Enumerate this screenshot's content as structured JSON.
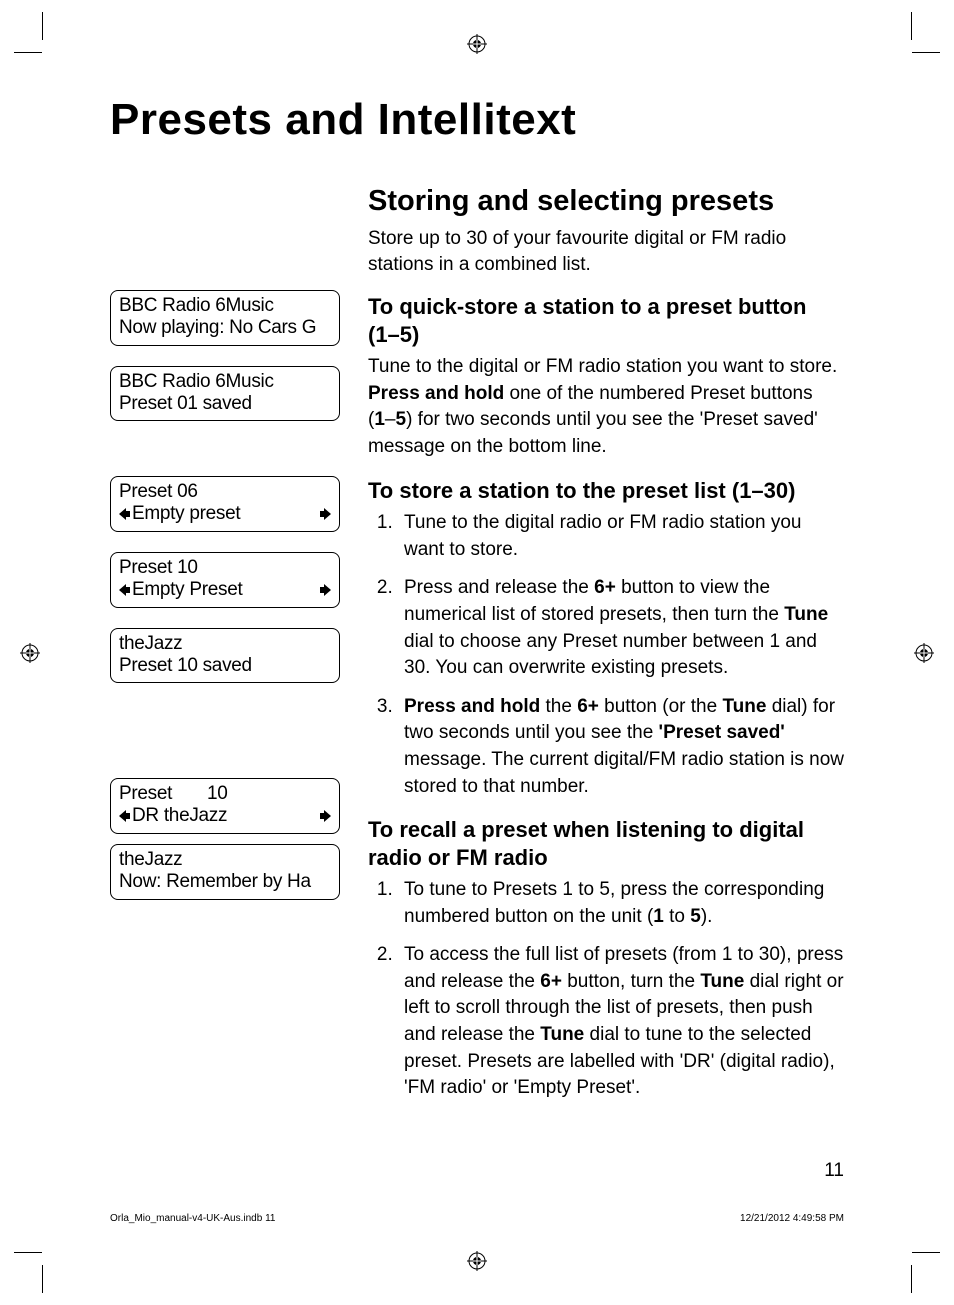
{
  "title": "Presets and Intellitext",
  "section": {
    "heading": "Storing and selecting presets",
    "intro": "Store up to 30 of your favourite digital or FM radio stations in a combined list."
  },
  "sub1": {
    "heading": "To quick-store a station to a preset button (1–5)",
    "para_parts": {
      "a": "Tune to the digital or FM radio station you want to store. ",
      "b": "Press and hold",
      "c": " one of the numbered Preset buttons (",
      "d": "1",
      "e": "–",
      "f": "5",
      "g": ") for two seconds until you see the 'Preset saved' message on the bottom line."
    }
  },
  "sub2": {
    "heading": "To store a station to the preset list (1–30)",
    "li1": "Tune to the digital radio or FM radio station you want to store.",
    "li2": {
      "a": "Press and release the ",
      "b": "6+",
      "c": " button to view the numerical list of stored presets, then turn the ",
      "d": "Tune",
      "e": " dial to choose any Preset number between 1 and 30. You can overwrite existing presets."
    },
    "li3": {
      "a": "Press and hold",
      "b": " the ",
      "c": "6+",
      "d": " button (or the ",
      "e": "Tune",
      "f": " dial) for two seconds until you see the ",
      "g": "'Preset saved'",
      "h": " message. The current digital/FM radio station is now stored to that number."
    }
  },
  "sub3": {
    "heading": "To recall a preset when listening to digital radio or FM radio",
    "li1": {
      "a": "To tune to Presets 1 to 5, press the corresponding numbered button on the unit (",
      "b": "1",
      "c": " to ",
      "d": "5",
      "e": ")."
    },
    "li2": {
      "a": "To access the full list of presets (from 1 to 30), press and release the ",
      "b": "6+",
      "c": " button, turn the ",
      "d": "Tune",
      "e": " dial right or left to scroll through the list of presets, then push and release the ",
      "f": "Tune",
      "g": " dial to tune to the selected preset. Presets are labelled with 'DR' (digital radio), 'FM radio' or 'Empty Preset'."
    }
  },
  "lcd": {
    "d1": {
      "l1": "BBC Radio 6Music",
      "l2": "Now playing: No Cars G"
    },
    "d2": {
      "l1": "BBC Radio 6Music",
      "l2": "Preset 01 saved"
    },
    "d3": {
      "l1": "Preset 06",
      "l2": "Empty preset"
    },
    "d4": {
      "l1": "Preset 10",
      "l2": "Empty Preset"
    },
    "d5": {
      "l1": "theJazz",
      "l2": "Preset 10 saved"
    },
    "d6": {
      "l1": "Preset       10",
      "l2": "DR theJazz"
    },
    "d7": {
      "l1": "theJazz",
      "l2": "Now: Remember by Ha"
    }
  },
  "page_number": "11",
  "footer": {
    "file": "Orla_Mio_manual-v4-UK-Aus.indb   11",
    "timestamp": "12/21/2012   4:49:58 PM"
  }
}
